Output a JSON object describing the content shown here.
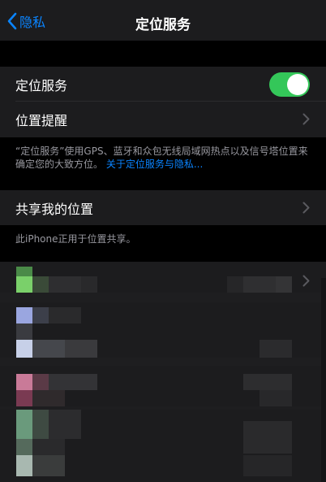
{
  "nav": {
    "back_label": "隐私",
    "title": "定位服务"
  },
  "location_services": {
    "label": "定位服务",
    "enabled": true
  },
  "location_alerts": {
    "label": "位置提醒"
  },
  "footer_location": {
    "text": "“定位服务”使用GPS、蓝牙和众包无线局域网热点以及信号塔位置来确定您的大致方位。",
    "link": "关于定位服务与隐私..."
  },
  "share_location": {
    "label": "共享我的位置"
  },
  "footer_share": {
    "text": "此iPhone正用于位置共享。"
  },
  "colors": {
    "accent": "#0a84ff",
    "toggle_on": "#34c759",
    "cell_background": "#1c1c1e",
    "secondary_text": "#98989f"
  }
}
